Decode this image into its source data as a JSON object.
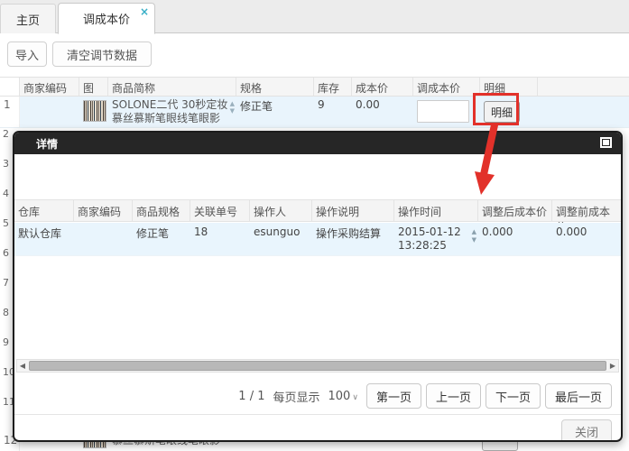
{
  "tabs": {
    "home_label": "主页",
    "active_label": "调成本价",
    "close_glyph": "×"
  },
  "toolbar": {
    "import_label": "导入",
    "clear_label": "清空调节数据"
  },
  "main_table": {
    "headers": [
      "商家编码",
      "图片",
      "商品简称",
      "规格",
      "库存",
      "成本价",
      "调成本价",
      "明细"
    ],
    "row1": {
      "index": "1",
      "merchant_code": "",
      "name_line1": "SOLONE二代 30秒定妆",
      "name_line2": "慕丝慕斯笔眼线笔眼影",
      "spec": "修正笔",
      "stock": "9",
      "cost_price": "0.00",
      "adjust_price_value": "",
      "detail_button_label": "明细"
    },
    "row_numbers": [
      "2",
      "3",
      "4",
      "5",
      "6",
      "7",
      "8",
      "9",
      "10",
      "11"
    ],
    "row12": {
      "index": "12",
      "name_partial": "慕丝慕斯笔眼线笔眼影"
    }
  },
  "modal": {
    "title": "详情",
    "table": {
      "headers": [
        "仓库",
        "商家编码",
        "商品规格",
        "关联单号",
        "操作人",
        "操作说明",
        "操作时间",
        "调整后成本价",
        "调整前成本价"
      ],
      "row": {
        "warehouse": "默认仓库",
        "merchant_code": "",
        "spec": "修正笔",
        "related_no": "18",
        "operator": "esunguo",
        "description": "操作采购结算",
        "time_line1": "2015-01-12",
        "time_line2": "13:28:25",
        "cost_after": "0.000",
        "cost_before": "0.000"
      }
    },
    "pagination": {
      "page": "1",
      "page_total": "/ 1",
      "per_page_label": "每页显示",
      "per_page_value": "100",
      "first_label": "第一页",
      "prev_label": "上一页",
      "next_label": "下一页",
      "last_label": "最后一页"
    },
    "close_label": "关闭"
  },
  "icons": {
    "sort_up": "▲",
    "sort_down": "▼",
    "scroll_left": "◀",
    "scroll_right": "▶",
    "select_caret": "∨"
  },
  "colors": {
    "annotation_red": "#e2312a",
    "selected_row_blue": "#e9f4fc",
    "modal_header_dark": "#262626",
    "tab_close_teal": "#35aec6"
  }
}
